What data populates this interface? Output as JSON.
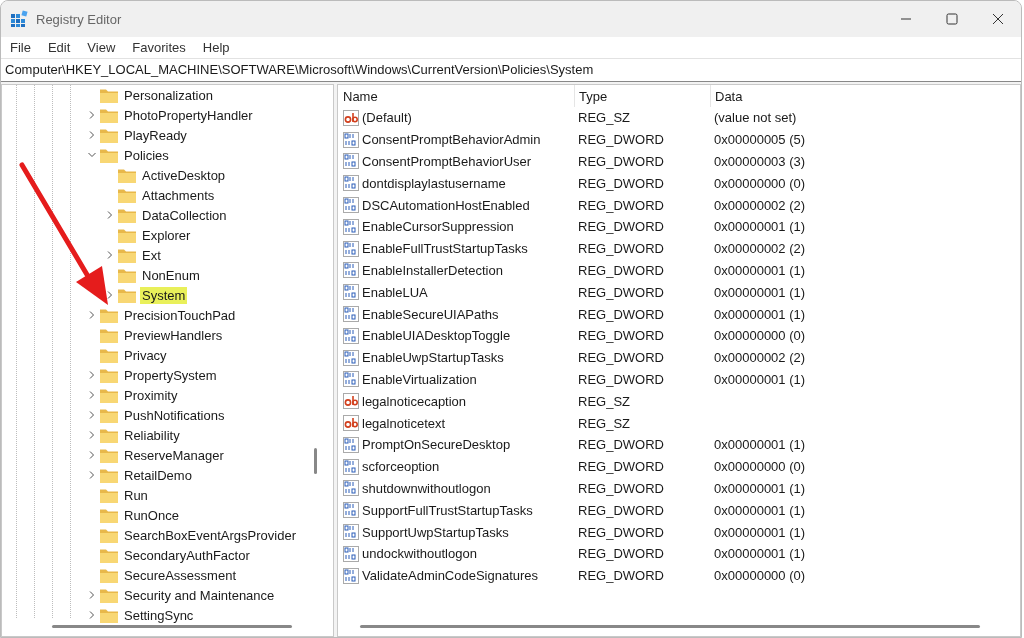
{
  "window": {
    "title": "Registry Editor"
  },
  "menu": [
    "File",
    "Edit",
    "View",
    "Favorites",
    "Help"
  ],
  "address": "Computer\\HKEY_LOCAL_MACHINE\\SOFTWARE\\Microsoft\\Windows\\CurrentVersion\\Policies\\System",
  "tree": [
    {
      "label": "Personalization",
      "selected": false
    },
    {
      "label": "PhotoPropertyHandler",
      "expanded": false,
      "selected": false
    },
    {
      "label": "PlayReady",
      "expanded": false,
      "selected": false
    },
    {
      "label": "Policies",
      "expanded": true,
      "selected": false,
      "children": [
        {
          "label": "ActiveDesktop",
          "selected": false
        },
        {
          "label": "Attachments",
          "selected": false
        },
        {
          "label": "DataCollection",
          "expanded": false,
          "selected": false
        },
        {
          "label": "Explorer",
          "selected": false
        },
        {
          "label": "Ext",
          "expanded": false,
          "selected": false
        },
        {
          "label": "NonEnum",
          "selected": false
        },
        {
          "label": "System",
          "expanded": false,
          "selected": true
        }
      ]
    },
    {
      "label": "PrecisionTouchPad",
      "expanded": false,
      "selected": false
    },
    {
      "label": "PreviewHandlers",
      "selected": false
    },
    {
      "label": "Privacy",
      "selected": false
    },
    {
      "label": "PropertySystem",
      "expanded": false,
      "selected": false
    },
    {
      "label": "Proximity",
      "expanded": false,
      "selected": false
    },
    {
      "label": "PushNotifications",
      "expanded": false,
      "selected": false
    },
    {
      "label": "Reliability",
      "expanded": false,
      "selected": false
    },
    {
      "label": "ReserveManager",
      "expanded": false,
      "selected": false
    },
    {
      "label": "RetailDemo",
      "expanded": false,
      "selected": false
    },
    {
      "label": "Run",
      "selected": false
    },
    {
      "label": "RunOnce",
      "selected": false
    },
    {
      "label": "SearchBoxEventArgsProvider",
      "selected": false
    },
    {
      "label": "SecondaryAuthFactor",
      "selected": false
    },
    {
      "label": "SecureAssessment",
      "selected": false
    },
    {
      "label": "Security and Maintenance",
      "expanded": false,
      "selected": false
    },
    {
      "label": "SettingSync",
      "expanded": false,
      "selected": false
    }
  ],
  "columns": [
    "Name",
    "Type",
    "Data"
  ],
  "values": [
    {
      "kind": "string",
      "name": "(Default)",
      "type": "REG_SZ",
      "data": "(value not set)"
    },
    {
      "kind": "dword",
      "name": "ConsentPromptBehaviorAdmin",
      "type": "REG_DWORD",
      "data": "0x00000005 (5)"
    },
    {
      "kind": "dword",
      "name": "ConsentPromptBehaviorUser",
      "type": "REG_DWORD",
      "data": "0x00000003 (3)"
    },
    {
      "kind": "dword",
      "name": "dontdisplaylastusername",
      "type": "REG_DWORD",
      "data": "0x00000000 (0)"
    },
    {
      "kind": "dword",
      "name": "DSCAutomationHostEnabled",
      "type": "REG_DWORD",
      "data": "0x00000002 (2)"
    },
    {
      "kind": "dword",
      "name": "EnableCursorSuppression",
      "type": "REG_DWORD",
      "data": "0x00000001 (1)"
    },
    {
      "kind": "dword",
      "name": "EnableFullTrustStartupTasks",
      "type": "REG_DWORD",
      "data": "0x00000002 (2)"
    },
    {
      "kind": "dword",
      "name": "EnableInstallerDetection",
      "type": "REG_DWORD",
      "data": "0x00000001 (1)"
    },
    {
      "kind": "dword",
      "name": "EnableLUA",
      "type": "REG_DWORD",
      "data": "0x00000001 (1)"
    },
    {
      "kind": "dword",
      "name": "EnableSecureUIAPaths",
      "type": "REG_DWORD",
      "data": "0x00000001 (1)"
    },
    {
      "kind": "dword",
      "name": "EnableUIADesktopToggle",
      "type": "REG_DWORD",
      "data": "0x00000000 (0)"
    },
    {
      "kind": "dword",
      "name": "EnableUwpStartupTasks",
      "type": "REG_DWORD",
      "data": "0x00000002 (2)"
    },
    {
      "kind": "dword",
      "name": "EnableVirtualization",
      "type": "REG_DWORD",
      "data": "0x00000001 (1)"
    },
    {
      "kind": "string",
      "name": "legalnoticecaption",
      "type": "REG_SZ"
    },
    {
      "kind": "string",
      "name": "legalnoticetext",
      "type": "REG_SZ"
    },
    {
      "kind": "dword",
      "name": "PromptOnSecureDesktop",
      "type": "REG_DWORD",
      "data": "0x00000001 (1)"
    },
    {
      "kind": "dword",
      "name": "scforceoption",
      "type": "REG_DWORD",
      "data": "0x00000000 (0)"
    },
    {
      "kind": "dword",
      "name": "shutdownwithoutlogon",
      "type": "REG_DWORD",
      "data": "0x00000001 (1)"
    },
    {
      "kind": "dword",
      "name": "SupportFullTrustStartupTasks",
      "type": "REG_DWORD",
      "data": "0x00000001 (1)"
    },
    {
      "kind": "dword",
      "name": "SupportUwpStartupTasks",
      "type": "REG_DWORD",
      "data": "0x00000001 (1)"
    },
    {
      "kind": "dword",
      "name": "undockwithoutlogon",
      "type": "REG_DWORD",
      "data": "0x00000001 (1)"
    },
    {
      "kind": "dword",
      "name": "ValidateAdminCodeSignatures",
      "type": "REG_DWORD",
      "data": "0x00000000 (0)"
    }
  ]
}
